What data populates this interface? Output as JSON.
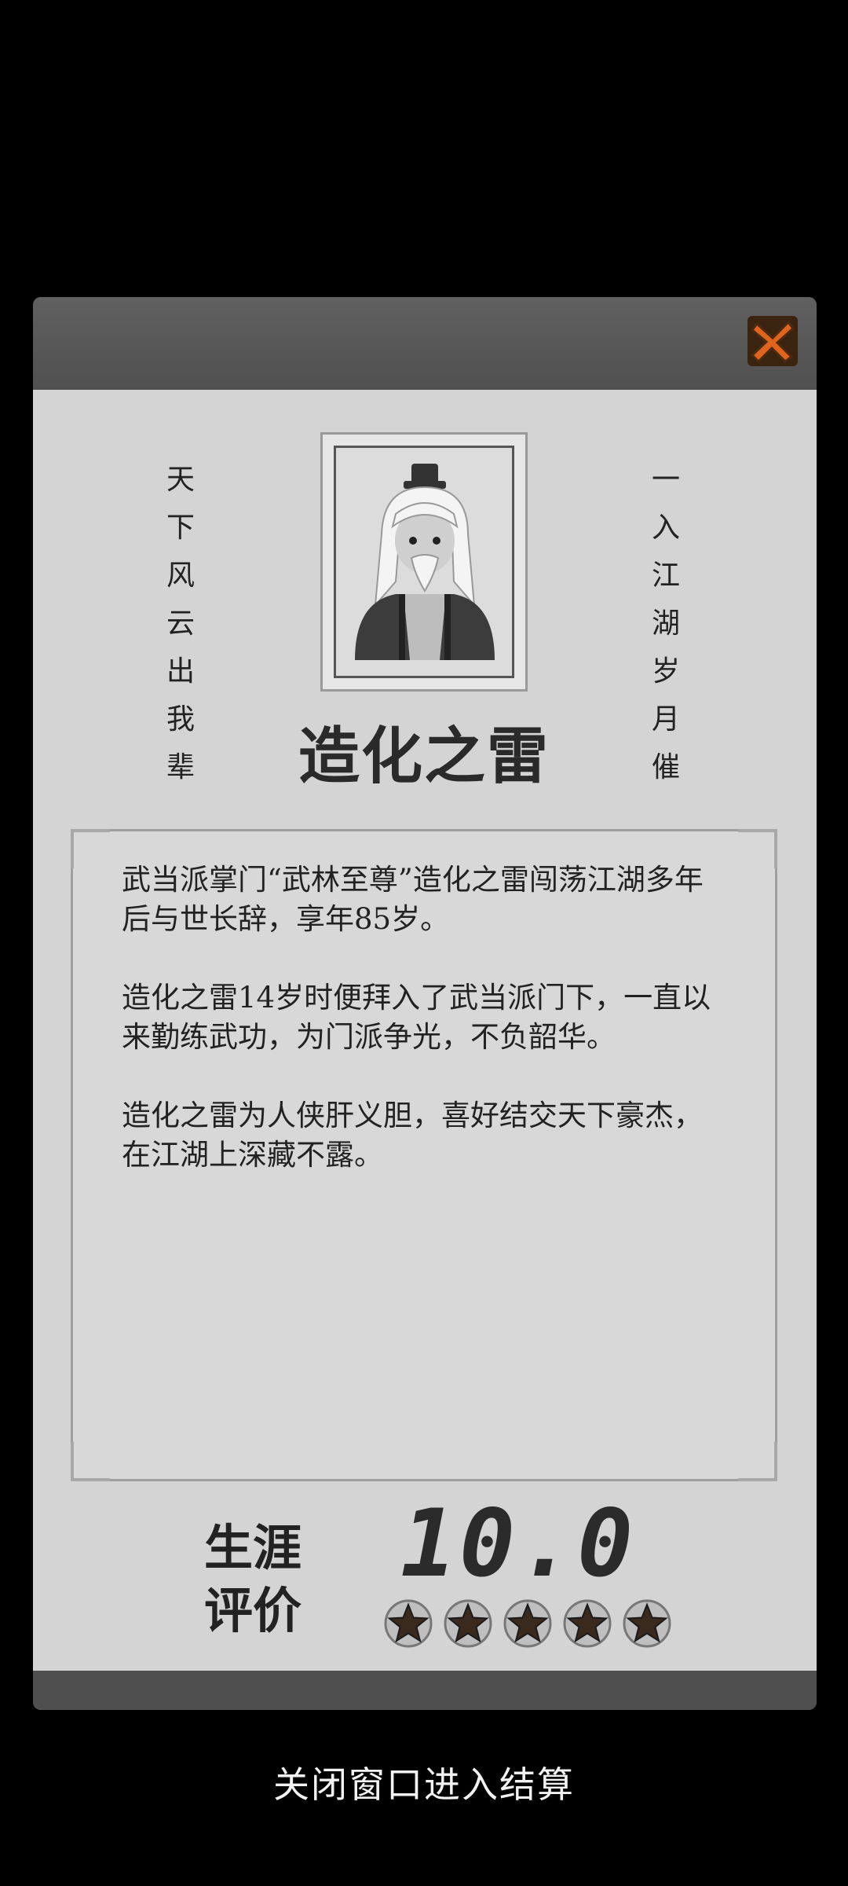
{
  "left_couplet": "天下风云出我辈",
  "right_couplet": "一入江湖岁月催",
  "character_name": "造化之雷",
  "biography": [
    "武当派掌门“武林至尊”造化之雷闯荡江湖多年后与世长辞，享年85岁。",
    "造化之雷14岁时便拜入了武当派门下，一直以来勤练武功，为门派争光，不负韶华。",
    "造化之雷为人侠肝义胆，喜好结交天下豪杰，在江湖上深藏不露。"
  ],
  "career_label": "生涯评价",
  "career_score": "10.0",
  "stars": {
    "filled": 5,
    "total": 5
  },
  "close_hint": "关闭窗口进入结算",
  "icons": {
    "close": "close-x-icon",
    "star": "star-icon"
  },
  "colors": {
    "close_accent": "#e0631e",
    "star_fill": "#3a2a1e"
  }
}
